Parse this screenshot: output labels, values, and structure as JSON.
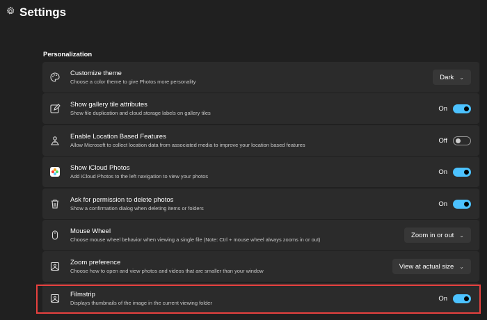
{
  "header": {
    "title": "Settings",
    "icon": "gear-icon"
  },
  "section": "Personalization",
  "rows": [
    {
      "icon": "palette-icon",
      "title": "Customize theme",
      "sub": "Choose a color theme to give Photos more personality",
      "control": "dropdown",
      "value": "Dark"
    },
    {
      "icon": "edit-icon",
      "title": "Show gallery tile attributes",
      "sub": "Show file duplication and cloud storage labels on gallery tiles",
      "control": "toggle",
      "state": "On"
    },
    {
      "icon": "location-icon",
      "title": "Enable Location Based Features",
      "sub": "Allow Microsoft to collect location data from associated media to improve your location based features",
      "control": "toggle",
      "state": "Off"
    },
    {
      "icon": "icloud-photos-icon",
      "title": "Show iCloud Photos",
      "sub": "Add iCloud Photos to the left navigation to view your photos",
      "control": "toggle",
      "state": "On"
    },
    {
      "icon": "trash-icon",
      "title": "Ask for permission to delete photos",
      "sub": "Show a confirmation dialog when deleting items or folders",
      "control": "toggle",
      "state": "On"
    },
    {
      "icon": "mouse-icon",
      "title": "Mouse Wheel",
      "sub": "Choose mouse wheel behavior when viewing a single file (Note: Ctrl + mouse wheel always zooms in or out)",
      "control": "dropdown",
      "value": "Zoom in or out"
    },
    {
      "icon": "image-icon",
      "title": "Zoom preference",
      "sub": "Choose how to open and view photos and videos that are smaller than your window",
      "control": "dropdown",
      "value": "View at actual size"
    },
    {
      "icon": "image-icon",
      "title": "Filmstrip",
      "sub": "Displays thumbnails of the image in the current viewing folder",
      "control": "toggle",
      "state": "On"
    }
  ],
  "colors": {
    "accent": "#4cc2ff",
    "highlight": "#e8413f",
    "card": "#2b2b2b",
    "bg": "#202020"
  }
}
